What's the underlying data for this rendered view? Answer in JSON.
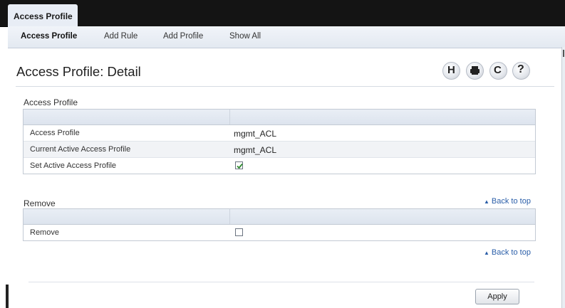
{
  "header": {
    "main_tab": "Access Profile"
  },
  "subnav": {
    "items": [
      {
        "label": "Access Profile",
        "active": true
      },
      {
        "label": "Add Rule",
        "active": false
      },
      {
        "label": "Add Profile",
        "active": false
      },
      {
        "label": "Show All",
        "active": false
      }
    ]
  },
  "page": {
    "title": "Access Profile: Detail"
  },
  "toolbar": {
    "icons": [
      "save-icon",
      "print-icon",
      "refresh-icon",
      "help-icon"
    ],
    "save_glyph": "H",
    "refresh_glyph": "C",
    "help_glyph": "?"
  },
  "access_profile_section": {
    "label": "Access Profile",
    "rows": [
      {
        "label": "Access Profile",
        "value": "mgmt_ACL"
      },
      {
        "label": "Current Active Access Profile",
        "value": "mgmt_ACL"
      },
      {
        "label": "Set Active Access Profile",
        "checked": true
      }
    ]
  },
  "remove_section": {
    "label": "Remove",
    "back_to_top": "Back to top",
    "rows": [
      {
        "label": "Remove",
        "checked": false
      }
    ]
  },
  "footer": {
    "back_to_top": "Back to top",
    "apply_label": "Apply"
  },
  "colors": {
    "topbar": "#141414",
    "link": "#2a5ea8",
    "header_row": "#e3e9f1"
  }
}
